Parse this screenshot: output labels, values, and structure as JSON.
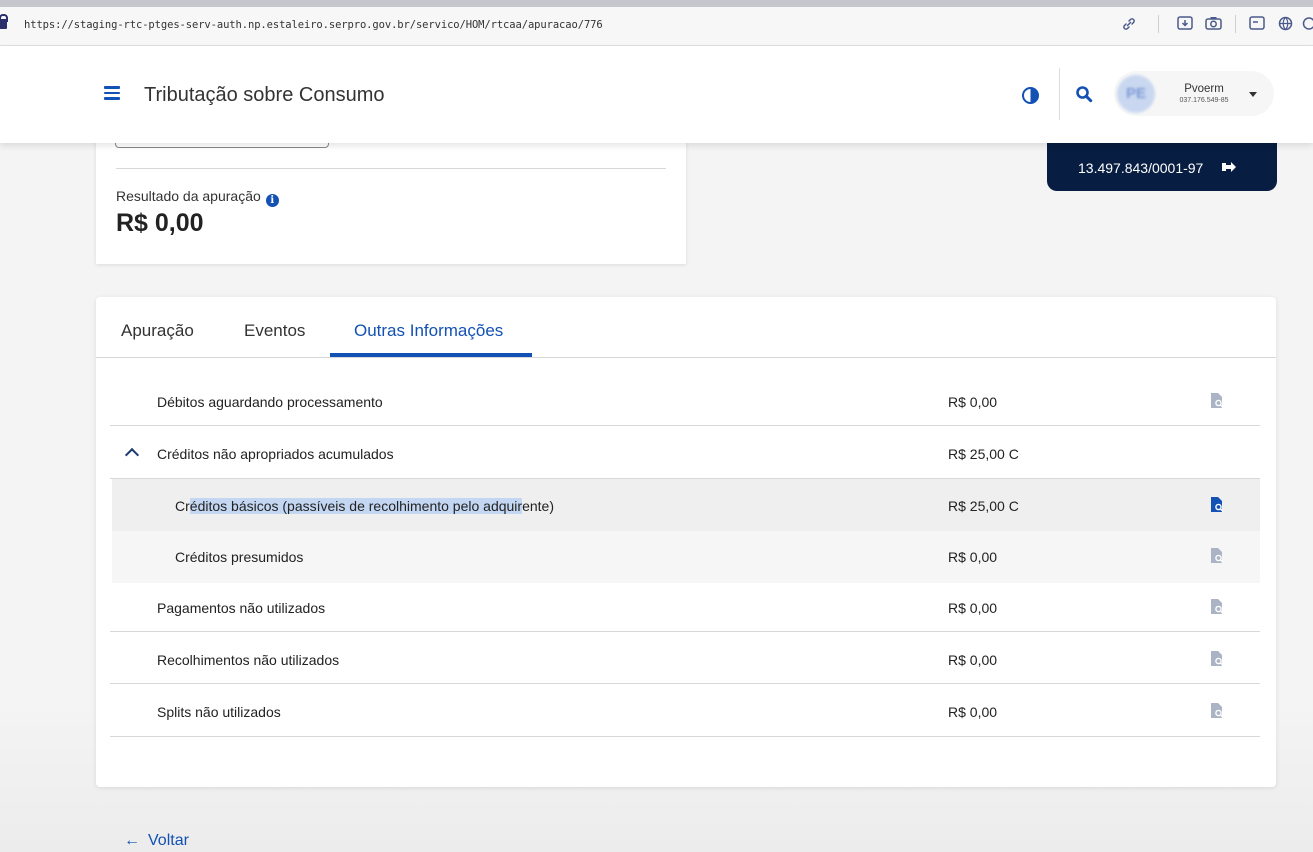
{
  "browser": {
    "url": "https://staging-rtc-ptges-serv-auth.np.estaleiro.serpro.gov.br/servico/HOM/rtcaa/apuracao/776"
  },
  "header": {
    "app_title": "Tributação sobre Consumo",
    "user": {
      "avatar_initials": "PE",
      "name": "Pvoerm",
      "id": "037.176.549-85"
    }
  },
  "summary": {
    "result_label": "Resultado da apuração",
    "result_value": "R$ 0,00"
  },
  "company": {
    "cnpj": "13.497.843/0001-97"
  },
  "tabs": [
    {
      "label": "Apuração",
      "active": false
    },
    {
      "label": "Eventos",
      "active": false
    },
    {
      "label": "Outras Informações",
      "active": true
    }
  ],
  "rows": [
    {
      "label": "Débitos aguardando processamento",
      "value": "R$ 0,00",
      "level": 0
    },
    {
      "label": "Créditos não apropriados acumulados",
      "value": "R$ 25,00 C",
      "level": 0,
      "expanded": true
    },
    {
      "label_prefix": "Cr",
      "label_selected": "éditos básicos (passíveis de recolhimento pelo adquir",
      "label_suffix": "ente)",
      "value": "R$ 25,00 C",
      "level": 1
    },
    {
      "label": "Créditos presumidos",
      "value": "R$ 0,00",
      "level": 1
    },
    {
      "label": "Pagamentos não utilizados",
      "value": "R$ 0,00",
      "level": 0
    },
    {
      "label": "Recolhimentos não utilizados",
      "value": "R$ 0,00",
      "level": 0
    },
    {
      "label": "Splits não utilizados",
      "value": "R$ 0,00",
      "level": 0
    }
  ],
  "back_link": "Voltar",
  "colors": {
    "primary": "#1351b4",
    "badge_bg": "#071d41",
    "disabled_icon": "#aab4c4"
  }
}
